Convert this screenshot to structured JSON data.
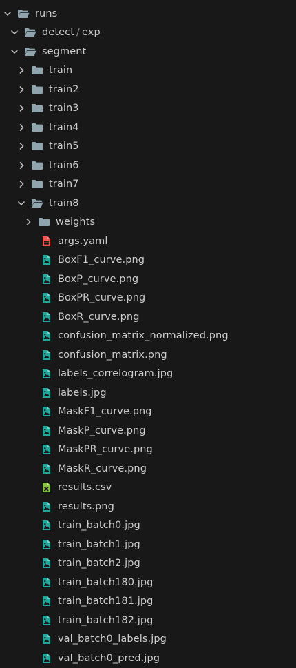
{
  "tree": {
    "runs": "runs",
    "detect": "detect",
    "exp": "exp",
    "segment": "segment",
    "folders": [
      "train",
      "train2",
      "train3",
      "train4",
      "train5",
      "train6",
      "train7"
    ],
    "train8": "train8",
    "weights": "weights",
    "files": [
      {
        "name": "args.yaml",
        "type": "yaml"
      },
      {
        "name": "BoxF1_curve.png",
        "type": "image"
      },
      {
        "name": "BoxP_curve.png",
        "type": "image"
      },
      {
        "name": "BoxPR_curve.png",
        "type": "image"
      },
      {
        "name": "BoxR_curve.png",
        "type": "image"
      },
      {
        "name": "confusion_matrix_normalized.png",
        "type": "image"
      },
      {
        "name": "confusion_matrix.png",
        "type": "image"
      },
      {
        "name": "labels_correlogram.jpg",
        "type": "image"
      },
      {
        "name": "labels.jpg",
        "type": "image"
      },
      {
        "name": "MaskF1_curve.png",
        "type": "image"
      },
      {
        "name": "MaskP_curve.png",
        "type": "image"
      },
      {
        "name": "MaskPR_curve.png",
        "type": "image"
      },
      {
        "name": "MaskR_curve.png",
        "type": "image"
      },
      {
        "name": "results.csv",
        "type": "csv"
      },
      {
        "name": "results.png",
        "type": "image"
      },
      {
        "name": "train_batch0.jpg",
        "type": "image"
      },
      {
        "name": "train_batch1.jpg",
        "type": "image"
      },
      {
        "name": "train_batch2.jpg",
        "type": "image"
      },
      {
        "name": "train_batch180.jpg",
        "type": "image"
      },
      {
        "name": "train_batch181.jpg",
        "type": "image"
      },
      {
        "name": "train_batch182.jpg",
        "type": "image"
      },
      {
        "name": "val_batch0_labels.jpg",
        "type": "image"
      },
      {
        "name": "val_batch0_pred.jpg",
        "type": "image"
      }
    ]
  },
  "colors": {
    "background": "#181818",
    "text": "#cccccc",
    "folder_icon": "#90a4ae",
    "image_icon": "#26a69a",
    "yaml_icon": "#ef5350",
    "csv_icon": "#8bc34a"
  }
}
